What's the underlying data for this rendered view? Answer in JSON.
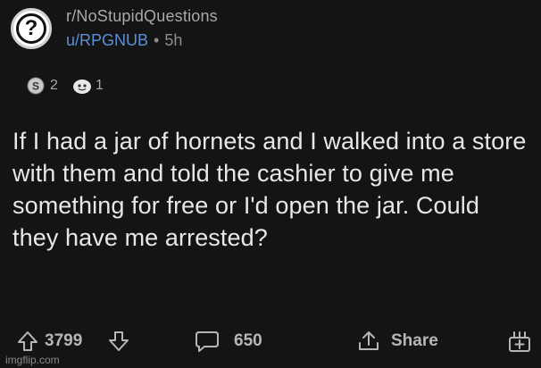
{
  "header": {
    "subreddit": "r/NoStupidQuestions",
    "username": "u/RPGNUB",
    "separator": "•",
    "time": "5h"
  },
  "awards": [
    {
      "icon": "silver-award-icon",
      "count": "2"
    },
    {
      "icon": "helpful-award-icon",
      "count": "1"
    }
  ],
  "post": {
    "title": "If I had a jar of hornets and I walked into a store with them and told the cashier to give me something for free or I'd open the jar. Could they have me arrested?"
  },
  "actions": {
    "votes": "3799",
    "comments": "650",
    "share_label": "Share"
  },
  "watermark": "imgflip.com"
}
